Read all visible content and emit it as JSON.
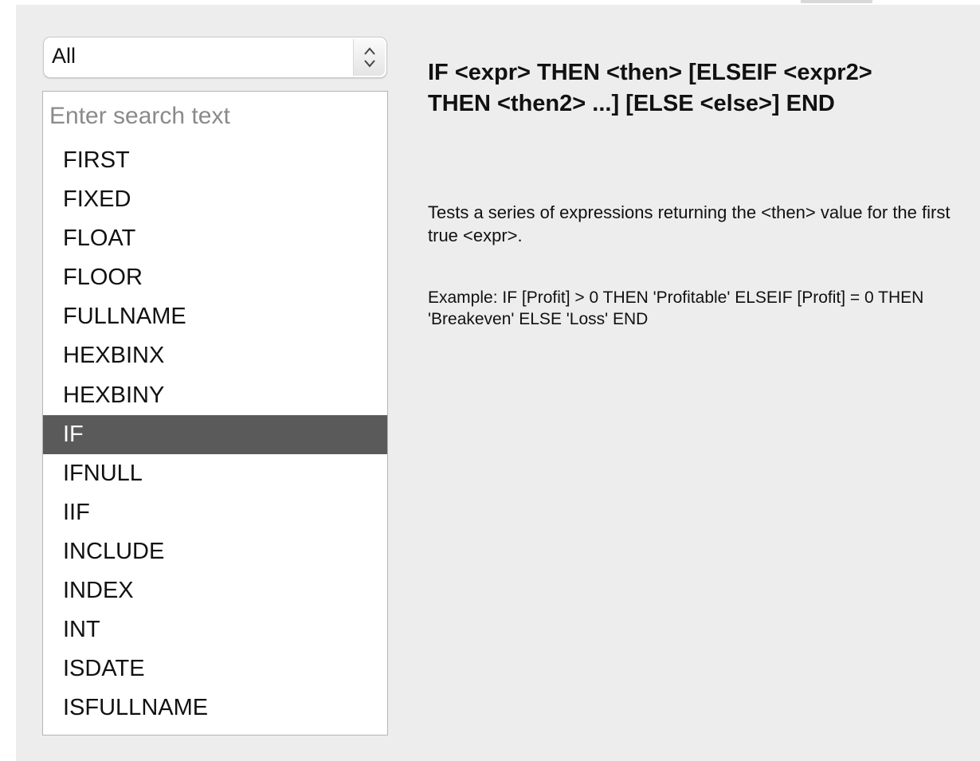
{
  "category_select": {
    "value": "All"
  },
  "search": {
    "placeholder": "Enter search text",
    "value": ""
  },
  "functions": [
    {
      "label": "FIRST",
      "selected": false
    },
    {
      "label": "FIXED",
      "selected": false
    },
    {
      "label": "FLOAT",
      "selected": false
    },
    {
      "label": "FLOOR",
      "selected": false
    },
    {
      "label": "FULLNAME",
      "selected": false
    },
    {
      "label": "HEXBINX",
      "selected": false
    },
    {
      "label": "HEXBINY",
      "selected": false
    },
    {
      "label": "IF",
      "selected": true
    },
    {
      "label": "IFNULL",
      "selected": false
    },
    {
      "label": "IIF",
      "selected": false
    },
    {
      "label": "INCLUDE",
      "selected": false
    },
    {
      "label": "INDEX",
      "selected": false
    },
    {
      "label": "INT",
      "selected": false
    },
    {
      "label": "ISDATE",
      "selected": false
    },
    {
      "label": "ISFULLNAME",
      "selected": false
    }
  ],
  "details": {
    "signature": "IF <expr> THEN <then> [ELSEIF <expr2> THEN <then2> ...] [ELSE <else>] END",
    "description": "Tests a series of expressions returning the <then> value for the first true <expr>.",
    "example": "Example: IF [Profit] > 0 THEN 'Profitable' ELSEIF [Profit] = 0 THEN 'Breakeven' ELSE 'Loss' END"
  },
  "icons": {
    "stepper": "up-down-chevron-icon"
  },
  "colors": {
    "selected_row_bg": "#5a5a5a",
    "selected_row_text": "#ffffff",
    "panel_bg": "#ededed"
  }
}
